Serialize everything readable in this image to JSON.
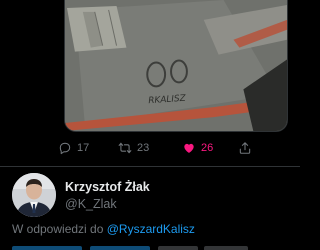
{
  "media": {
    "handwriting": "RKALISZ",
    "colors": {
      "concrete": "#6f716c",
      "formwork": "#b6543c",
      "board": "#a4a59c"
    }
  },
  "actions": {
    "reply": {
      "count": "17",
      "icon": "reply-icon"
    },
    "retweet": {
      "count": "23",
      "icon": "retweet-icon"
    },
    "like": {
      "count": "26",
      "icon": "heart-filled-icon",
      "liked": true,
      "color": "#f91880"
    },
    "share": {
      "icon": "share-icon"
    }
  },
  "tweet": {
    "author_name": "Krzysztof Żłak",
    "author_handle": "@K_Zlak",
    "reply_prefix": "W odpowiedzi do",
    "reply_to": "@RyszardKalisz"
  },
  "colors": {
    "link": "#1d9bf0",
    "muted": "#71767b",
    "text": "#e7e9ea",
    "background": "#000000"
  }
}
